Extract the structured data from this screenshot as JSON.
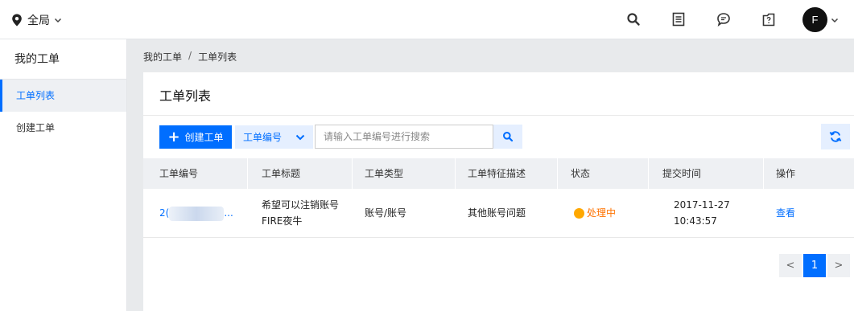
{
  "topbar": {
    "region_label": "全局",
    "avatar_initial": "F"
  },
  "sidebar": {
    "title": "我的工单",
    "items": [
      {
        "label": "工单列表",
        "active": true
      },
      {
        "label": "创建工单",
        "active": false
      }
    ]
  },
  "breadcrumb": {
    "items": [
      "我的工单",
      "工单列表"
    ],
    "separator": "/"
  },
  "main": {
    "title": "工单列表",
    "toolbar": {
      "create_label": "创建工单",
      "filter_field": "工单编号",
      "search_placeholder": "请输入工单编号进行搜索"
    },
    "table": {
      "columns": [
        "工单编号",
        "工单标题",
        "工单类型",
        "工单特征描述",
        "状态",
        "提交时间",
        "操作"
      ],
      "rows": [
        {
          "id_prefix": "2(",
          "id_suffix": "...",
          "title_line1": "希望可以注销账号",
          "title_line2": "FIRE夜牛",
          "type": "账号/账号",
          "description": "其他账号问题",
          "status": "处理中",
          "date": "2017-11-27",
          "time": "10:43:57",
          "action": "查看"
        }
      ]
    },
    "pagination": {
      "prev": "<",
      "current": "1",
      "next": ">"
    }
  },
  "colors": {
    "accent": "#006eff",
    "status_processing": "#ff7200",
    "status_dot": "#ffa800"
  }
}
